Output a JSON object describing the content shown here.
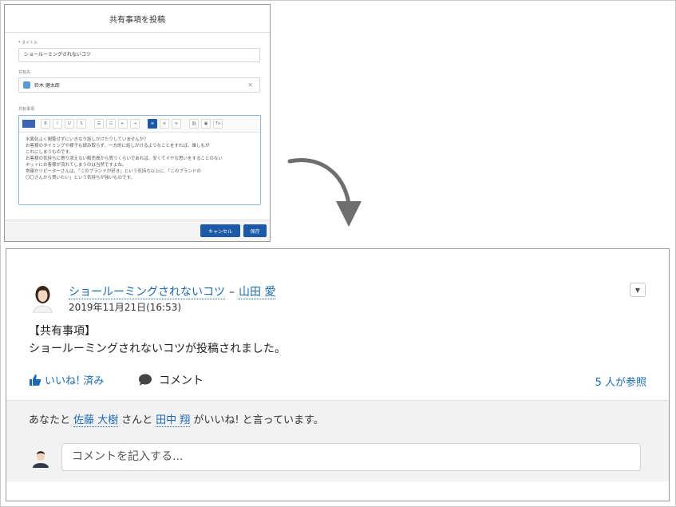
{
  "modal": {
    "title": "共有事項を投稿",
    "title_field_label": "タイトル",
    "required_mark": "*",
    "title_value": "ショールーミングされないコツ",
    "sharer_label": "共有先",
    "sharer_name": "鈴木 健太郎",
    "body_label": "共有事項",
    "toolbar_buttons": [
      "B",
      "I",
      "U",
      "S",
      "☰",
      "☷",
      "⇤",
      "⇥",
      "≡",
      "≡",
      "≡",
      "⛓",
      "▣",
      "Tx"
    ],
    "body_lines": [
      "水面化よく閲覧せずにいきなり話しかけたりしていませんか？",
      "お客様のタイミングや様子も読み取らず、一方的に話しかけるようなことをすれば、誰しもが",
      "これにしまうものです。",
      "お客様の気持ちに寄り添えない販売員から買うくらいであれば、安くてイヤな思いをすることのない",
      "ネットにお客様が流れてしまうのは当然ですよね。",
      "常連かリピーターさんは、「このブランドが好き」という気持ち以上に、「このブランドの",
      "〇〇さんから買いたい」という気持ちが強いものです。"
    ],
    "cancel_label": "キャンセル",
    "save_label": "保存"
  },
  "post": {
    "title": "ショールーミングされないコツ",
    "separator": "–",
    "author": "山田 愛",
    "datetime": "2019年11月21日(16:53)",
    "body_heading": "【共有事項】",
    "body_text": "ショールーミングされないコツが投稿されました。",
    "like_label": "いいね! 済み",
    "comment_label": "コメント",
    "participants": "5 人が参照",
    "likes": {
      "prefix": "あなたと",
      "person1": "佐藤 大樹",
      "middle": "さんと",
      "person2": "田中 翔",
      "suffix": "がいいね! と言っています。"
    },
    "comment_placeholder": "コメントを記入する..."
  },
  "colors": {
    "link": "#1a6ab3",
    "button_primary": "#1c5aa8",
    "panel_bg": "#f2f2f2"
  },
  "icons": [
    "thumbs-up-icon",
    "speech-bubble-icon",
    "chevron-down-icon",
    "close-icon",
    "curved-arrow-icon"
  ]
}
